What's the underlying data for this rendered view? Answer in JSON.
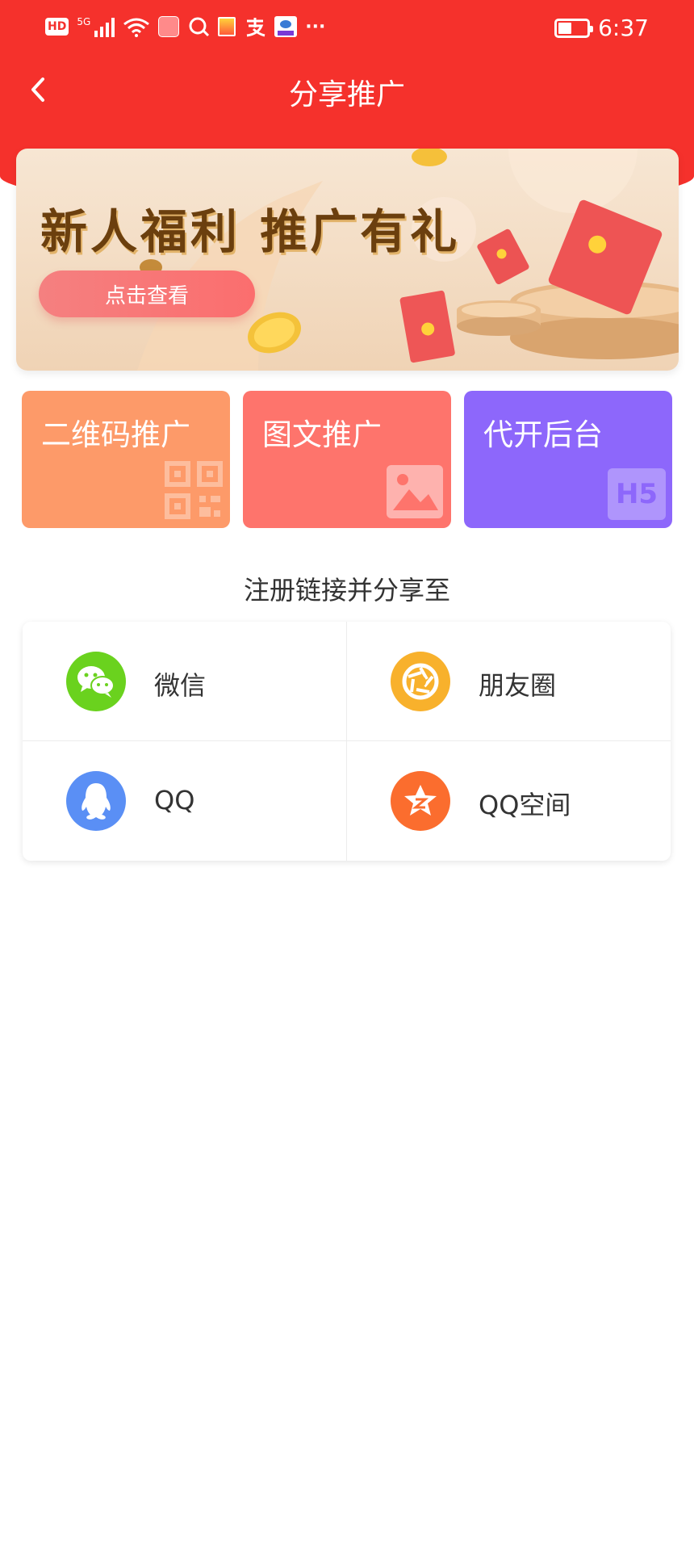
{
  "status_bar": {
    "hd_badge": "HD",
    "network": "5G",
    "more": "···",
    "time": "6:37"
  },
  "nav": {
    "title": "分享推广"
  },
  "banner": {
    "title": "新人福利 推广有礼",
    "button_label": "点击查看"
  },
  "features": [
    {
      "label": "二维码推广",
      "color": "#fd9a69",
      "icon": "qr-code-icon"
    },
    {
      "label": "图文推广",
      "color": "#fe746c",
      "icon": "image-icon"
    },
    {
      "label": "代开后台",
      "color": "#8d67fb",
      "icon": "h5-icon",
      "icon_text": "H5"
    }
  ],
  "share_section": {
    "title": "注册链接并分享至",
    "targets": [
      {
        "label": "微信",
        "icon": "wechat-icon",
        "color": "#6ad21e"
      },
      {
        "label": "朋友圈",
        "icon": "moments-icon",
        "color": "#f8b12c"
      },
      {
        "label": "QQ",
        "icon": "qq-icon",
        "color": "#5a8ff5"
      },
      {
        "label": "QQ空间",
        "icon": "qzone-icon",
        "color": "#fb6d2e"
      }
    ]
  }
}
